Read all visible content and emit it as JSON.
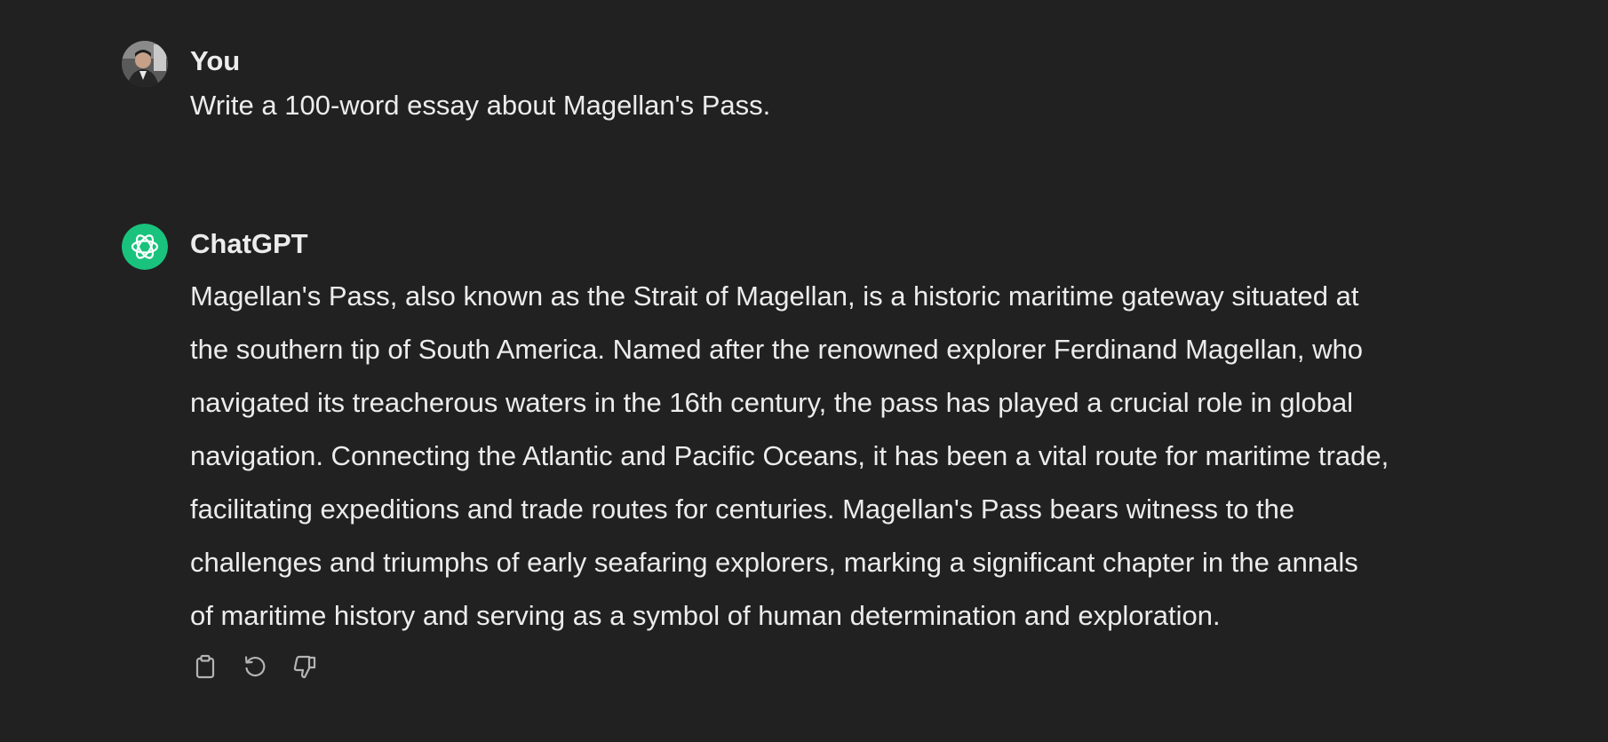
{
  "user_turn": {
    "author": "You",
    "message": "Write a 100-word essay about Magellan's Pass."
  },
  "assistant_turn": {
    "author": "ChatGPT",
    "lines": [
      "Magellan's Pass, also known as the Strait of Magellan, is a historic maritime gateway situated at",
      "the southern tip of South America. Named after the renowned explorer Ferdinand Magellan, who",
      "navigated its treacherous waters in the 16th century, the pass has played a crucial role in global",
      "navigation. Connecting the Atlantic and Pacific Oceans, it has been a vital route for maritime trade,",
      "facilitating expeditions and trade routes for centuries. Magellan's Pass bears witness to the",
      "challenges and triumphs of early seafaring explorers, marking a significant chapter in the annals",
      "of maritime history and serving as a symbol of human determination and exploration."
    ],
    "actions": [
      {
        "icon": "clipboard-icon"
      },
      {
        "icon": "regenerate-icon"
      },
      {
        "icon": "thumbs-down-icon"
      }
    ]
  },
  "colors": {
    "background": "#212121",
    "text": "#ececec",
    "icon": "#b4b4b4",
    "assistant_avatar": "#19c37d"
  }
}
